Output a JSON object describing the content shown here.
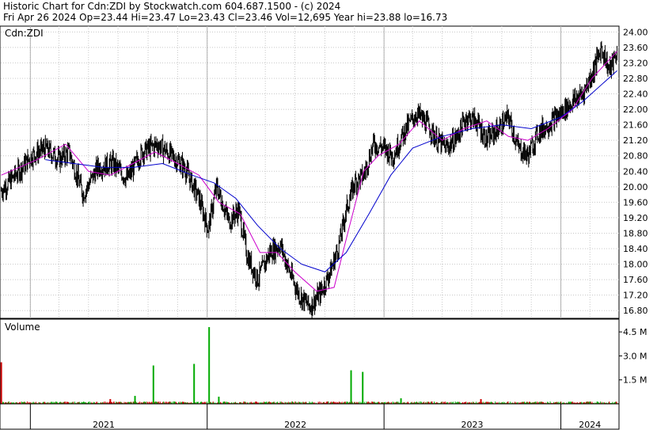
{
  "header": {
    "line1": "Historic Chart for Cdn:ZDI by Stockwatch.com 604.687.1500 - (c) 2024",
    "line2": "Fri Apr 26 2024   Op=23.44  Hi=23.47  Lo=23.43  Cl=23.46  Vol=12,695  Year hi=23.88  lo=16.73"
  },
  "chart_data": [
    {
      "type": "line",
      "panel_label": "Cdn:ZDI",
      "mark_style": "high-low bars",
      "y_ticks": [
        "16.80",
        "17.20",
        "17.60",
        "18.00",
        "18.40",
        "18.80",
        "19.20",
        "19.60",
        "20.00",
        "20.40",
        "20.80",
        "21.20",
        "21.60",
        "22.00",
        "22.40",
        "22.80",
        "23.20",
        "23.60",
        "24.00"
      ],
      "ylim": [
        16.6,
        24.15
      ],
      "x_labels": [
        "2021",
        "2022",
        "2023",
        "2024"
      ],
      "xlim": [
        "2020-11-01",
        "2024-04-30"
      ],
      "grid": true,
      "colors": {
        "price": "#000000",
        "ma_short": "#cc00cc",
        "ma_long": "#0000cc",
        "grid": "#c8c8c8"
      },
      "series": [
        {
          "key": "price",
          "x": [
            "2020-11-02",
            "2020-12-01",
            "2021-01-04",
            "2021-02-01",
            "2021-03-01",
            "2021-03-22",
            "2021-04-20",
            "2021-05-20",
            "2021-06-20",
            "2021-07-20",
            "2021-08-20",
            "2021-09-20",
            "2021-10-20",
            "2021-11-15",
            "2021-12-15",
            "2022-01-03",
            "2022-01-20",
            "2022-02-01",
            "2022-02-15",
            "2022-03-07",
            "2022-03-25",
            "2022-04-15",
            "2022-05-10",
            "2022-06-01",
            "2022-06-20",
            "2022-07-10",
            "2022-08-01",
            "2022-08-25",
            "2022-09-15",
            "2022-09-30",
            "2022-10-15",
            "2022-11-01",
            "2022-11-20",
            "2022-12-10",
            "2023-01-01",
            "2023-01-20",
            "2023-02-15",
            "2023-03-10",
            "2023-04-01",
            "2023-04-20",
            "2023-05-10",
            "2023-06-01",
            "2023-06-20",
            "2023-07-10",
            "2023-08-01",
            "2023-08-25",
            "2023-09-15",
            "2023-10-05",
            "2023-10-25",
            "2023-11-15",
            "2023-12-05",
            "2024-01-01",
            "2024-01-25",
            "2024-02-15",
            "2024-03-05",
            "2024-03-25",
            "2024-04-10",
            "2024-04-26"
          ],
          "y": [
            19.9,
            20.3,
            20.8,
            21.0,
            20.7,
            20.9,
            19.8,
            20.5,
            20.6,
            20.2,
            20.9,
            21.1,
            20.8,
            20.5,
            19.7,
            18.9,
            20.0,
            19.6,
            19.1,
            19.4,
            18.2,
            17.6,
            18.3,
            18.5,
            17.8,
            17.2,
            16.9,
            17.3,
            17.9,
            18.5,
            19.4,
            20.1,
            20.3,
            21.1,
            21.0,
            20.8,
            21.5,
            21.9,
            21.6,
            21.2,
            21.0,
            21.3,
            21.8,
            21.7,
            21.2,
            21.5,
            21.8,
            21.0,
            20.8,
            21.4,
            21.6,
            21.9,
            22.2,
            22.4,
            22.9,
            23.6,
            23.0,
            23.46
          ]
        },
        {
          "key": "ma_short",
          "x": [
            "2020-11-02",
            "2021-01-15",
            "2021-03-15",
            "2021-05-01",
            "2021-06-15",
            "2021-08-01",
            "2021-09-15",
            "2021-11-01",
            "2021-12-15",
            "2022-01-25",
            "2022-03-10",
            "2022-04-20",
            "2022-05-25",
            "2022-07-01",
            "2022-08-15",
            "2022-09-20",
            "2022-10-20",
            "2022-11-20",
            "2022-12-20",
            "2023-02-01",
            "2023-03-15",
            "2023-05-01",
            "2023-06-15",
            "2023-08-01",
            "2023-09-15",
            "2023-10-25",
            "2023-12-05",
            "2024-01-25",
            "2024-03-05",
            "2024-04-26"
          ],
          "y": [
            20.3,
            20.7,
            21.1,
            20.4,
            20.3,
            20.6,
            20.9,
            20.6,
            20.3,
            19.6,
            19.3,
            18.3,
            18.3,
            17.8,
            17.3,
            17.4,
            18.9,
            20.4,
            20.8,
            21.1,
            21.7,
            21.2,
            21.5,
            21.7,
            21.3,
            21.2,
            21.5,
            22.0,
            22.8,
            23.5
          ]
        },
        {
          "key": "ma_long",
          "x": [
            "2021-02-01",
            "2021-04-01",
            "2021-06-01",
            "2021-08-01",
            "2021-10-01",
            "2021-12-01",
            "2022-01-15",
            "2022-03-01",
            "2022-04-15",
            "2022-06-01",
            "2022-07-15",
            "2022-09-01",
            "2022-10-15",
            "2022-12-01",
            "2023-01-15",
            "2023-03-01",
            "2023-05-01",
            "2023-07-01",
            "2023-09-01",
            "2023-11-01",
            "2024-01-01",
            "2024-02-15",
            "2024-04-26"
          ],
          "y": [
            20.7,
            20.6,
            20.5,
            20.5,
            20.6,
            20.3,
            20.1,
            19.7,
            19.0,
            18.4,
            18.0,
            17.8,
            18.3,
            19.3,
            20.3,
            21.0,
            21.3,
            21.5,
            21.6,
            21.5,
            21.8,
            22.2,
            23.0
          ]
        }
      ]
    },
    {
      "type": "bar",
      "panel_label": "Volume",
      "y_ticks": [
        "1.5 M",
        "3.0 M",
        "4.5 M"
      ],
      "ylim": [
        0,
        5.1
      ],
      "unit": "M",
      "colors": {
        "up": "#00aa00",
        "down": "#cc0000"
      },
      "x": [
        "2020-11-02",
        "2021-08-05",
        "2021-09-12",
        "2021-12-05",
        "2022-01-05",
        "2022-01-25",
        "2022-10-25",
        "2022-11-18",
        "2021-06-15",
        "2023-02-05",
        "2023-07-20"
      ],
      "values": [
        2.6,
        0.5,
        2.4,
        2.5,
        4.8,
        0.45,
        2.1,
        2.0,
        0.3,
        0.35,
        0.3
      ],
      "direction": [
        "down",
        "up",
        "up",
        "up",
        "up",
        "up",
        "up",
        "up",
        "down",
        "up",
        "down"
      ]
    }
  ]
}
